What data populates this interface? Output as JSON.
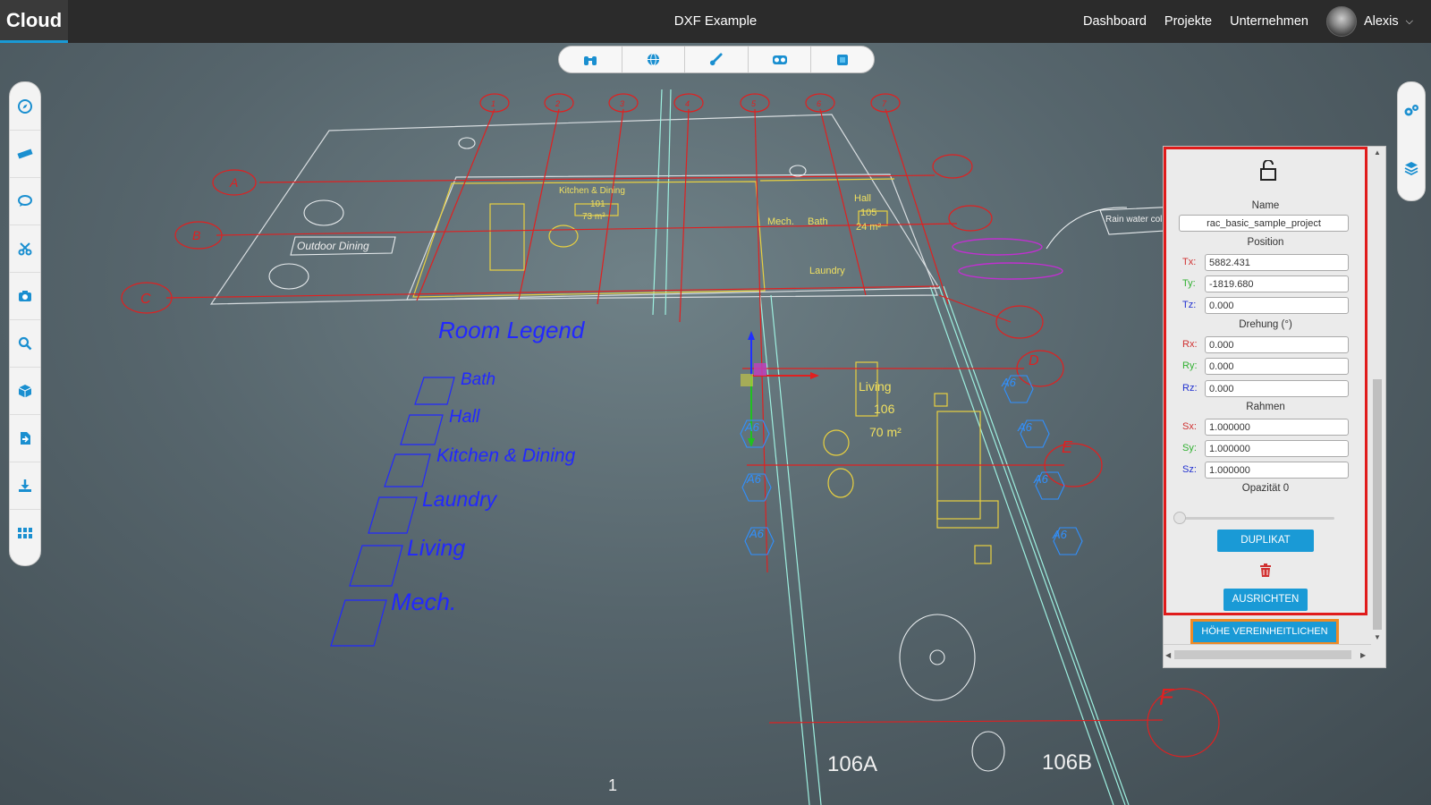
{
  "header": {
    "brand": "Cloud",
    "title": "DXF Example",
    "nav": [
      "Dashboard",
      "Projekte",
      "Unternehmen"
    ],
    "user": "Alexis"
  },
  "view_toolbar": [
    "binoculars-icon",
    "globe-icon",
    "brush-icon",
    "vr-headset-icon",
    "cube-icon"
  ],
  "left_toolbar": [
    "compass-icon",
    "ruler-icon",
    "comment-icon",
    "scissors-icon",
    "camera-icon",
    "search-icon",
    "box-icon",
    "file-import-icon",
    "download-icon",
    "grid-icon"
  ],
  "right_toolbar": [
    "settings-icon",
    "layers-icon"
  ],
  "panel": {
    "name_label": "Name",
    "name_value": "rac_basic_sample_project",
    "position_label": "Position",
    "tx_label": "Tx:",
    "tx": "5882.431",
    "ty_label": "Ty:",
    "ty": "-1819.680",
    "tz_label": "Tz:",
    "tz": "0.000",
    "rotation_label": "Drehung (°)",
    "rx_label": "Rx:",
    "rx": "0.000",
    "ry_label": "Ry:",
    "ry": "0.000",
    "rz_label": "Rz:",
    "rz": "0.000",
    "scale_label": "Rahmen",
    "sx_label": "Sx:",
    "sx": "1.000000",
    "sy_label": "Sy:",
    "sy": "1.000000",
    "sz_label": "Sz:",
    "sz": "1.000000",
    "opacity_label": "Opazität 0",
    "opacity_value": 0,
    "duplicate_button": "DUPLIKAT",
    "align_button": "AUSRICHTEN",
    "unify_height_button": "HÖHE VEREINHEITLICHEN"
  },
  "drawing": {
    "legend_title": "Room Legend",
    "legend_items": [
      "Bath",
      "Hall",
      "Kitchen & Dining",
      "Laundry",
      "Living",
      "Mech."
    ],
    "rooms": {
      "kitchen": "Kitchen & Dining",
      "kitchen_num": "101",
      "kitchen_area": "73 m²",
      "hall": "Hall",
      "hall_num": "105",
      "hall_area": "24 m²",
      "mech": "Mech.",
      "bath": "Bath",
      "laundry": "Laundry",
      "living": "Living",
      "living_num": "106",
      "living_area": "70 m²",
      "outdoor": "Outdoor Dining",
      "r106a": "106A",
      "r106b": "106B",
      "rain": "Rain water collection tanks"
    },
    "grid_letters": [
      "A",
      "B",
      "C",
      "D",
      "E",
      "F"
    ],
    "grid_numbers": [
      "1",
      "2",
      "3",
      "4",
      "5",
      "6",
      "7"
    ],
    "tags": [
      "A6",
      "A6",
      "A6",
      "A6",
      "A6",
      "A6",
      "A6"
    ],
    "bottom_marker": "1"
  }
}
